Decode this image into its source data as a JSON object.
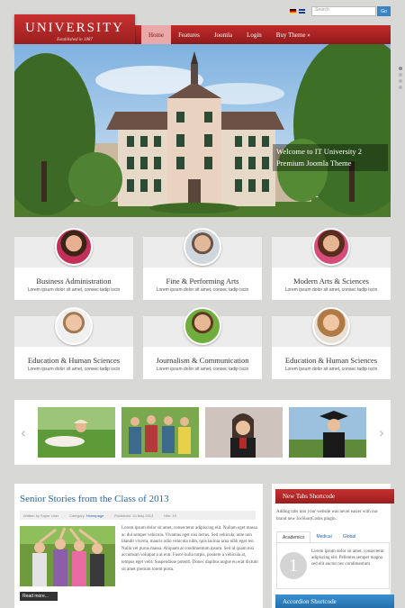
{
  "header": {
    "logo_title": "UNIVERSITY",
    "logo_tagline": "Established in 1887",
    "search_placeholder": "Search",
    "search_button": "Go"
  },
  "nav": {
    "items": [
      {
        "label": "Home",
        "active": true
      },
      {
        "label": "Features"
      },
      {
        "label": "Joomla"
      },
      {
        "label": "Login"
      },
      {
        "label": "Buy Theme »"
      }
    ]
  },
  "hero": {
    "caption_line1": "Welcome to IT University 2",
    "caption_line2": "Premium Joomla Theme",
    "slide_count": 4,
    "active_slide": 1
  },
  "departments": [
    {
      "title": "Business Administration",
      "text": "Lorem ipsum dolor sit amet, consec tadip iscin"
    },
    {
      "title": "Fine & Performing Arts",
      "text": "Lorem ipsum dolor sit amet, consec tadip iscin"
    },
    {
      "title": "Modern Arts & Sciences",
      "text": "Lorem ipsum dolor sit amet, consec tadip iscin"
    },
    {
      "title": "Education & Human Sciences",
      "text": "Lorem ipsum dolor sit amet, consec tadip iscin"
    },
    {
      "title": "Journalism & Communication",
      "text": "Lorem ipsum dolor sit amet, consec tadip iscin"
    },
    {
      "title": "Education & Human Sciences",
      "text": "Lorem ipsum dolor sit amet, consec tadip iscin"
    }
  ],
  "carousel": {
    "prev": "‹",
    "next": "›"
  },
  "article": {
    "title": "Senior Stories from the Class of 2013",
    "written_by": "Written by Super User",
    "category_label": "Category:",
    "category": "Homepage",
    "published": "Published: 15 May 2013",
    "hits": "Hits: 19",
    "body": "Lorem ipsum dolor sit amet, consectetur adipiscing elit. Nullam eget massa ac dui semper vehicula. Vivamus eget nisi lectus. Sed vehicula, ante non blandit viverra, mauris odio vehicula nibh, quis lacinia urna nibh eget leo. Nulla vel purus massa. Aliquam at condimentum ipsum. Sed id quam nisi accumsan volutpat a at erat. Fusce nulla turpis, posuere a vehicula at, tempus eget velit. Suspendisse potenti. Donec dapibus augue eu erat dictum sit amet pretium lorem porta.",
    "read_more": "Read more..."
  },
  "sidebar": {
    "tabs_title": "New Tabs Shortcode",
    "intro": "Adding tabs into your website was never easier with our brand new IceShortCodes plugin.",
    "tabs": [
      {
        "label": "Academics",
        "active": true
      },
      {
        "label": "Medical"
      },
      {
        "label": "Global"
      }
    ],
    "tab_number": "1",
    "tab_text": "Lorem ipsum dolor sit amet, consectetur adipiscing elit. Pellentes semper magna sed elit auctor nec condimentum",
    "accordion_title": "Accordion Shortcode"
  },
  "colors": {
    "brand_red": "#b02424",
    "link_blue": "#2b66a8",
    "accordion_blue": "#2c7fc0"
  }
}
